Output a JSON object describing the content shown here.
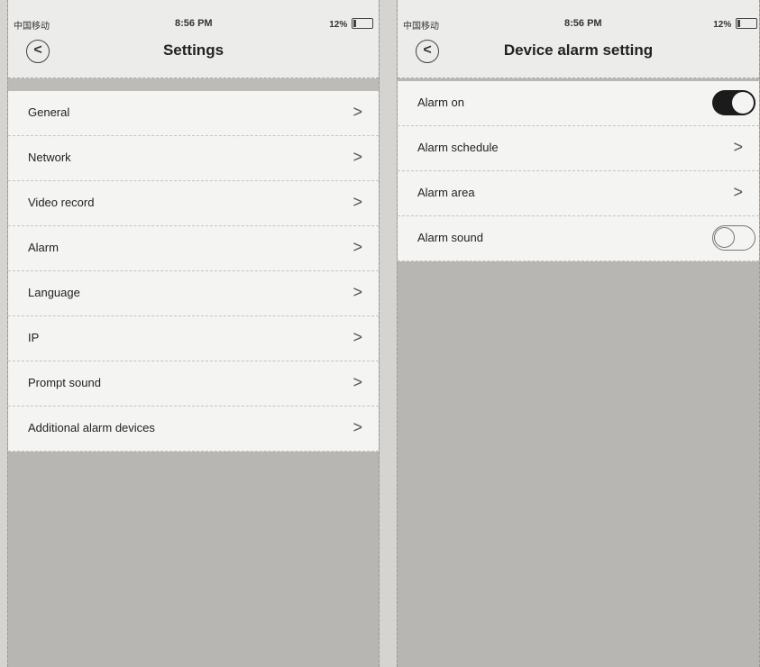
{
  "left_screen": {
    "status": {
      "carrier": "中国移动",
      "time": "8:56 PM",
      "battery": "12%"
    },
    "title": "Settings",
    "items": [
      {
        "label": "General"
      },
      {
        "label": "Network"
      },
      {
        "label": "Video record"
      },
      {
        "label": "Alarm"
      },
      {
        "label": "Language"
      },
      {
        "label": "IP"
      },
      {
        "label": "Prompt sound"
      },
      {
        "label": "Additional alarm devices"
      }
    ]
  },
  "right_screen": {
    "status": {
      "carrier": "中国移动",
      "time": "8:56 PM",
      "battery": "12%"
    },
    "title": "Device alarm setting",
    "items": [
      {
        "label": "Alarm on",
        "control": "toggle",
        "state": "on"
      },
      {
        "label": "Alarm schedule",
        "control": "chevron"
      },
      {
        "label": "Alarm area",
        "control": "chevron"
      },
      {
        "label": "Alarm sound",
        "control": "toggle",
        "state": "off"
      }
    ]
  },
  "icons": {
    "back": "<",
    "chevron": ">"
  }
}
